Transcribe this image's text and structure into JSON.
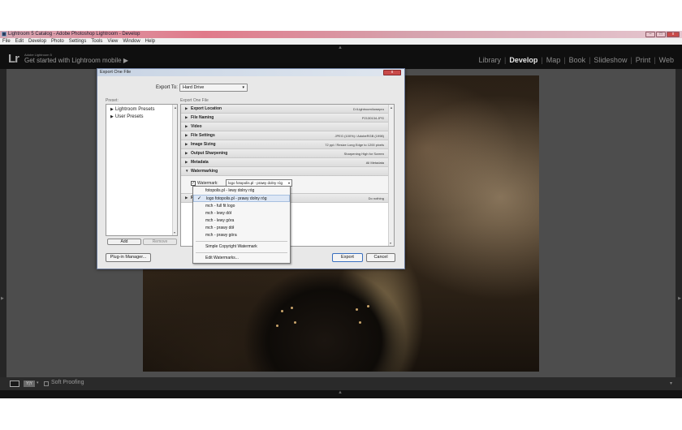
{
  "window": {
    "title": "Lightroom 5 Catalog - Adobe Photoshop Lightroom - Develop",
    "controls": {
      "minimize": "–",
      "maximize": "□",
      "close": "x"
    }
  },
  "menu": [
    "File",
    "Edit",
    "Develop",
    "Photo",
    "Settings",
    "Tools",
    "View",
    "Window",
    "Help"
  ],
  "lr": {
    "logo": "Lr",
    "version": "Adobe Lightroom 5",
    "mobile_prompt": "Get started with Lightroom mobile",
    "mobile_arrow": "▶",
    "modules": [
      "Library",
      "Develop",
      "Map",
      "Book",
      "Slideshow",
      "Print",
      "Web"
    ],
    "active_module": "Develop",
    "separator": "|"
  },
  "toolbar": {
    "view_yy": "Y|Y",
    "soft_proofing": "Soft Proofing",
    "down_arrow": "▾",
    "collapse_up": "▲",
    "menu_arrow": "▾"
  },
  "dialog": {
    "title": "Export One File",
    "close": "x",
    "export_to_label": "Export To:",
    "export_to_value": "Hard Drive",
    "select_arrow": "▾",
    "preset_label": "Preset:",
    "export_one_label": "Export One File",
    "presets": [
      "Lightroom Presets",
      "User Presets"
    ],
    "add_label": "Add",
    "remove_label": "Remove",
    "plugin_label": "Plug-in Manager...",
    "export_label": "Export",
    "cancel_label": "Cancel",
    "collapsed_tri": "▶",
    "expanded_tri": "▼",
    "sections": [
      {
        "name": "Export Location",
        "summary": "D:\\Lightroom\\lowepro"
      },
      {
        "name": "File Naming",
        "summary": "P2130134.JPG"
      },
      {
        "name": "Video",
        "summary": ""
      },
      {
        "name": "File Settings",
        "summary": "JPEG (100%) / AdobeRGB (1998)"
      },
      {
        "name": "Image Sizing",
        "summary": "72 ppi / Resize Long Edge to 1200 pixels"
      },
      {
        "name": "Output Sharpening",
        "summary": "Sharpening High for Screen"
      },
      {
        "name": "Metadata",
        "summary": "All Metadata"
      },
      {
        "name": "Watermarking",
        "summary": ""
      }
    ],
    "post_processing": {
      "name": "Post-Processing",
      "visible_prefix": "P",
      "summary": "Do nothing"
    },
    "watermark": {
      "label": "Watermark:",
      "checked": true,
      "check_glyph": "✓",
      "selected": "logo fotopolis.pl - prawy dolny róg"
    },
    "watermark_menu": {
      "group1": [
        "fotopolis.pl - lewy dolny róg",
        "logo fotopolis.pl - prawy dolny róg",
        "mch - full fit logo",
        "mch - lewy dół",
        "mch - lewy góra",
        "mch - prawy dół",
        "mch - prawy góra"
      ],
      "group2": [
        "Simple Copyright Watermark"
      ],
      "group3": [
        "Edit Watermarks..."
      ],
      "checked_item": "logo fotopolis.pl - prawy dolny róg",
      "check_glyph": "✓"
    }
  },
  "colors": {
    "lr_background": "#4d4d4d",
    "lr_panel": "#0f0f0f",
    "title_bar": "#e07a8a",
    "close_button": "#c84a4a",
    "menu_highlight": "#dde7f5"
  }
}
